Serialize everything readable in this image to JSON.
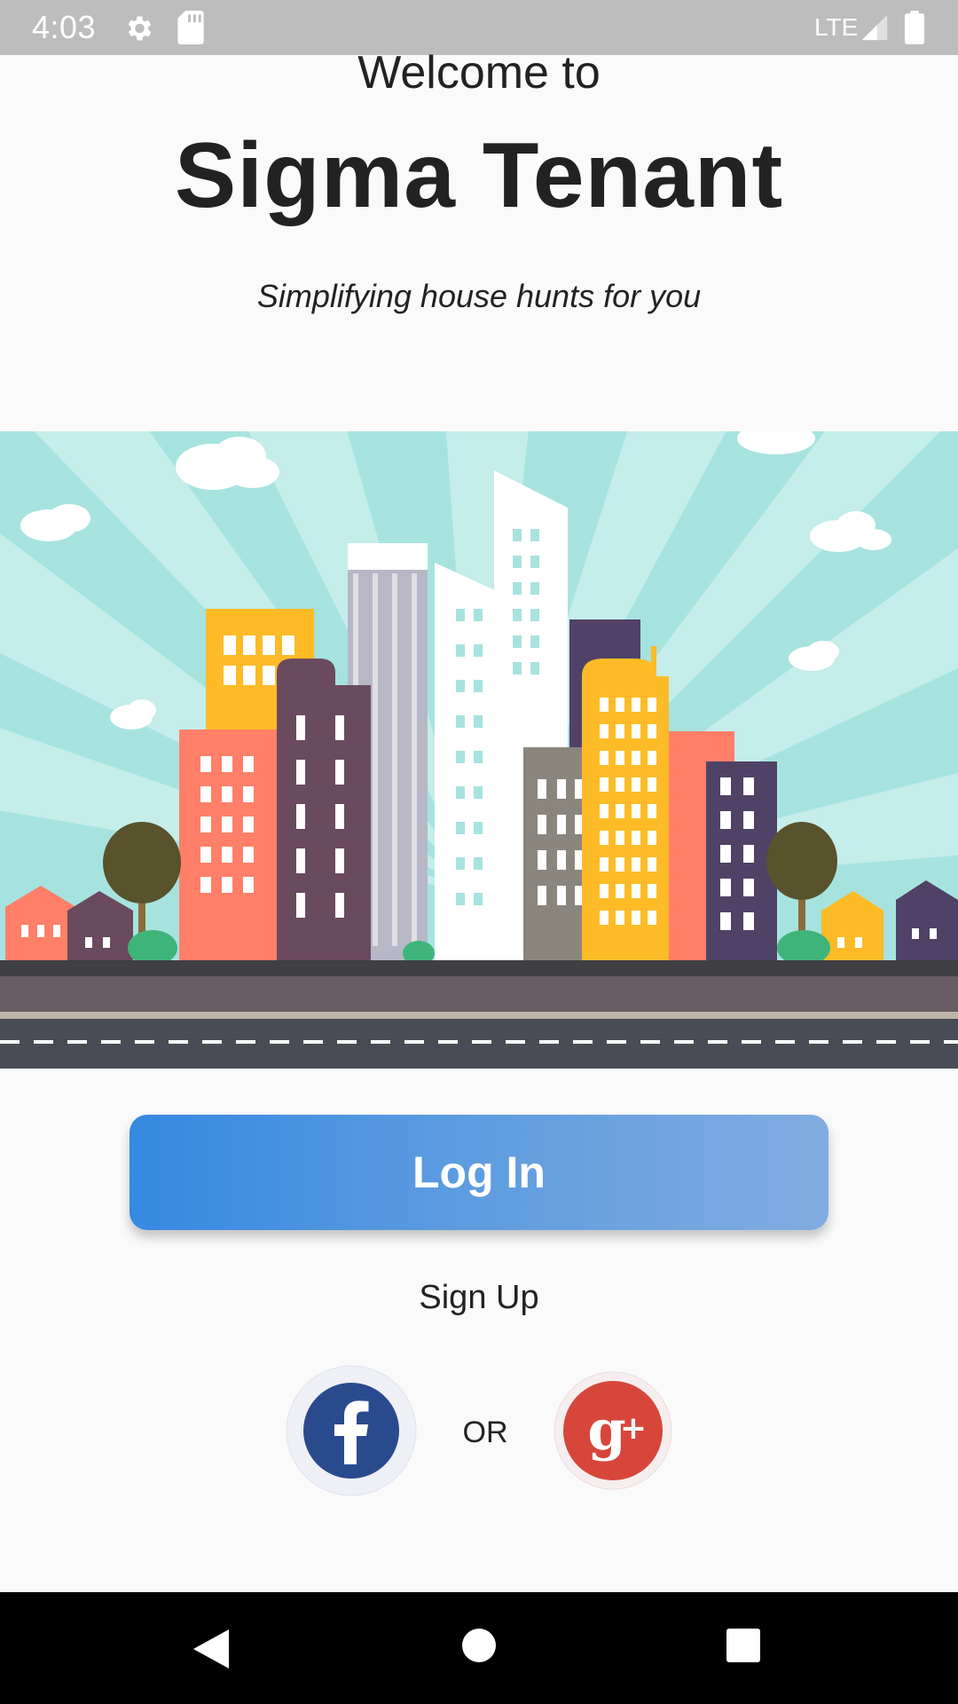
{
  "status_bar": {
    "time": "4:03",
    "network": "LTE",
    "icons": [
      "settings-gear-icon",
      "sd-card-icon",
      "signal-icon",
      "battery-icon"
    ]
  },
  "header": {
    "welcome": "Welcome to",
    "title": "Sigma Tenant",
    "tagline": "Simplifying house hunts for you"
  },
  "hero": {
    "illustration": "city-skyline-illustration"
  },
  "actions": {
    "login_label": "Log In",
    "signup_label": "Sign Up",
    "or_label": "OR",
    "facebook_icon": "facebook-icon",
    "google_icon": "google-plus-icon"
  },
  "nav_bar": {
    "icons": [
      "back-icon",
      "home-icon",
      "recents-icon"
    ]
  },
  "colors": {
    "login_gradient_start": "#3589e0",
    "login_gradient_end": "#82ace0",
    "facebook": "#2a4a8e",
    "google": "#d7463b",
    "status_bar": "#bdbdbd",
    "sky": "#a6e3df"
  }
}
